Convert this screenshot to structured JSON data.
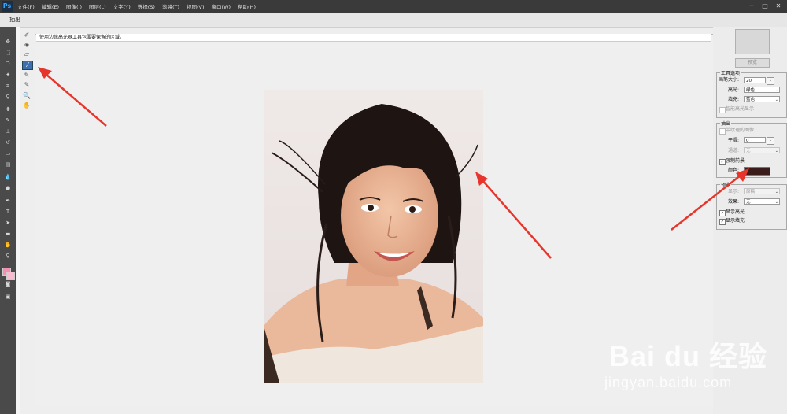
{
  "app": {
    "logo": "Ps",
    "dialog_title": "抽出"
  },
  "menu": [
    "文件(F)",
    "编辑(E)",
    "图像(I)",
    "图层(L)",
    "文字(Y)",
    "选择(S)",
    "滤镜(T)",
    "视图(V)",
    "窗口(W)",
    "帮助(H)"
  ],
  "window_controls": [
    "─",
    "□",
    "✕"
  ],
  "canvas": {
    "hint": "使用边缘高光器工具包围要保留的区域。"
  },
  "buttons": {
    "ok": "",
    "preview": "预览"
  },
  "tool_options": {
    "title": "工具选项",
    "brush_size_label": "画笔大小:",
    "brush_size_value": "20",
    "highlight_label": "高光:",
    "highlight_value": "绿色",
    "fill_label": "填充:",
    "fill_value": "蓝色",
    "smart_highlight": "智能高光显示"
  },
  "extraction": {
    "title": "抽出",
    "textured_image": "带纹理的图像",
    "smooth_label": "平滑:",
    "smooth_value": "0",
    "channel_label": "通道:",
    "channel_value": "无",
    "force_foreground": "强制前景",
    "force_foreground_checked": true,
    "color_label": "颜色:",
    "color_value": "#3a1d1a"
  },
  "preview_group": {
    "title": "预览",
    "show_label": "显示:",
    "show_value": "原稿",
    "effect_label": "效果:",
    "effect_value": "无",
    "show_highlight": "显示高光",
    "show_fill": "显示填充"
  },
  "watermark": {
    "logo_text": "Bai du 经验",
    "url": "jingyan.baidu.com"
  },
  "colors": {
    "menubar": "#3a3a3a",
    "arrow": "#e8352c",
    "active_tool": "#3b6fb0",
    "swatch": "#3a1d1a"
  }
}
